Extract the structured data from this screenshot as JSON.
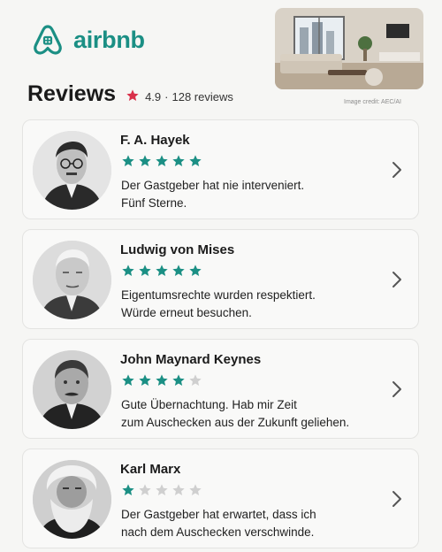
{
  "brand": {
    "name": "airbnb",
    "color": "#1b8f84"
  },
  "header": {
    "title": "Reviews",
    "rating": "4.9",
    "separator": "·",
    "review_count": "128 reviews",
    "image_credit": "Image credit: AEC/AI"
  },
  "reviews": [
    {
      "name": "F. A. Hayek",
      "stars": 5,
      "text_line1": "Der Gastgeber hat nie interveniert.",
      "text_line2": "Fünf Sterne."
    },
    {
      "name": "Ludwig von Mises",
      "stars": 5,
      "text_line1": "Eigentumsrechte wurden respektiert.",
      "text_line2": "Würde erneut besuchen."
    },
    {
      "name": "John Maynard Keynes",
      "stars": 4,
      "text_line1": "Gute Übernachtung. Hab mir Zeit",
      "text_line2": "zum Auschecken aus der Zukunft geliehen."
    },
    {
      "name": "Karl Marx",
      "stars": 1,
      "text_line1": "Der Gastgeber hat erwartet, dass ich",
      "text_line2": "nach dem Auschecken verschwinde."
    }
  ],
  "icons": {
    "rating": "star-icon",
    "card_action": "chevron-right-icon",
    "logo": "airbnb-logo-icon"
  },
  "colors": {
    "star_on": "#1b8f84",
    "star_off": "#cfcfcf",
    "rating_star": "#d9304a"
  }
}
